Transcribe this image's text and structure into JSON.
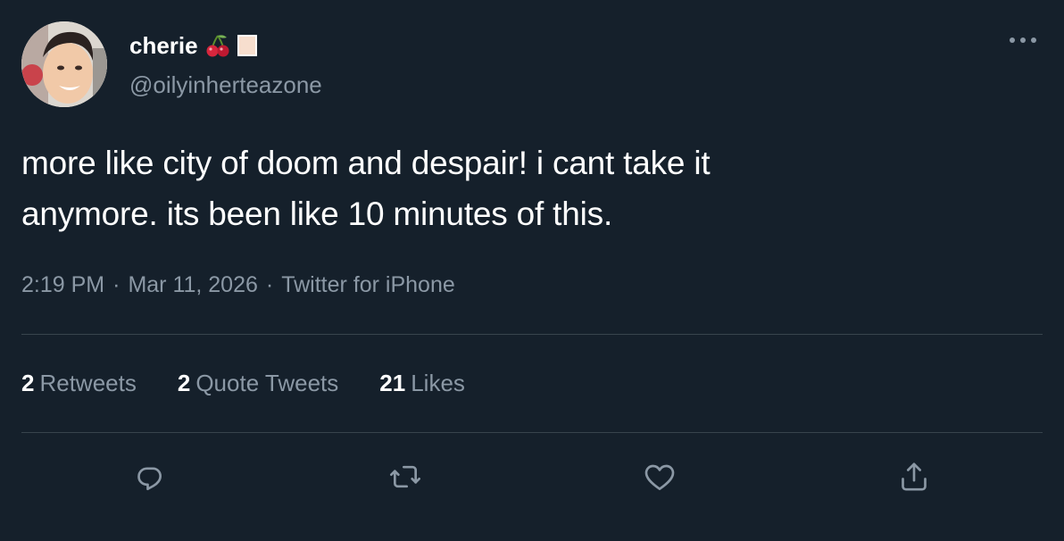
{
  "user": {
    "display_name": "cherie",
    "handle": "@oilyinherteazone",
    "name_emojis": [
      "cherries-icon",
      "skin-tone-swatch-icon"
    ]
  },
  "tweet": {
    "text_line1": "more like city of doom and despair! i cant take it",
    "text_line2": "anymore. its been like 10 minutes of this.",
    "time": "2:19 PM",
    "separator": "·",
    "date": "Mar 11, 2026",
    "source": "Twitter for iPhone"
  },
  "stats": {
    "retweets": {
      "count": "2",
      "label": "Retweets"
    },
    "quote_tweets": {
      "count": "2",
      "label": "Quote Tweets"
    },
    "likes": {
      "count": "21",
      "label": "Likes"
    }
  },
  "actions": [
    "reply-icon",
    "retweet-icon",
    "like-icon",
    "share-icon"
  ],
  "colors": {
    "background": "#15202b",
    "primary_text": "#ffffff",
    "secondary_text": "#8b98a5",
    "divider": "#38444d"
  }
}
